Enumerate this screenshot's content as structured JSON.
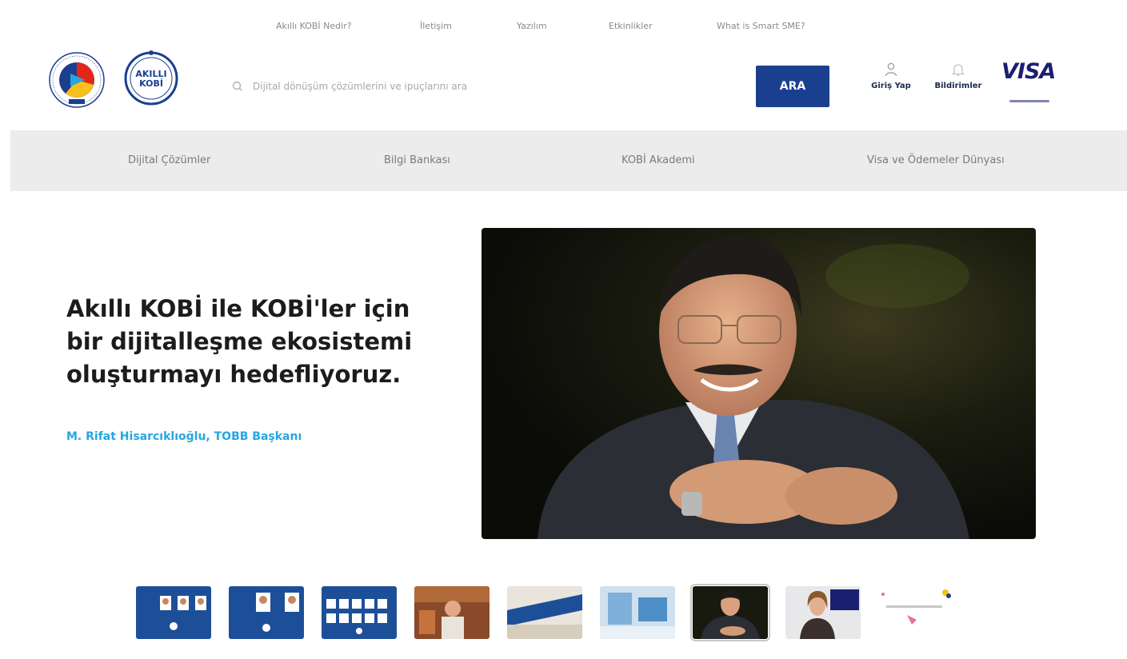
{
  "top_links": [
    "Akıllı KOBİ Nedir?",
    "İletişim",
    "Yazılım",
    "Etkinlikler",
    "What is Smart SME?"
  ],
  "logos": {
    "akilli_line1": "AKILLI",
    "akilli_line2": "KOBİ"
  },
  "search": {
    "placeholder": "Dijital dönüşüm çözümlerini ve ipuçlarını ara",
    "button_label": "ARA"
  },
  "header_actions": {
    "login_label": "Giriş Yap",
    "notifications_label": "Bildirimler"
  },
  "visa": {
    "logo_text": "VISA"
  },
  "nav": [
    "Dijital Çözümler",
    "Bilgi Bankası",
    "KOBİ Akademi",
    "Visa ve Ödemeler Dünyası"
  ],
  "hero": {
    "title": "Akıllı KOBİ ile KOBİ'ler için bir dijitalleşme ekosistemi oluşturmayı hedefliyoruz.",
    "author": "M. Rifat Hisarcıklıoğlu, TOBB Başkanı"
  },
  "thumbnails": {
    "count": 9,
    "active_index": 6
  },
  "colors": {
    "brand_blue": "#1b3f8f",
    "accent_cyan": "#26a6e0",
    "visa_blue": "#1a1f71",
    "nav_bg": "#ececec"
  }
}
